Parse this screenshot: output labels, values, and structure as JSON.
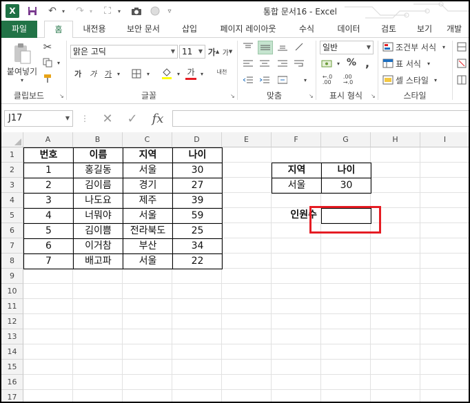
{
  "window": {
    "title": "통합 문서16 - Excel",
    "app_icon": "X"
  },
  "tabs": [
    "파일",
    "홈",
    "내전용",
    "보안 문서",
    "삽입",
    "페이지 레이아웃",
    "수식",
    "데이터",
    "검토",
    "보기",
    "개발"
  ],
  "ribbon": {
    "clipboard": {
      "paste_label": "붙여넣기",
      "group_label": "클립보드"
    },
    "font": {
      "font_name": "맑은 고딕",
      "font_size": "11",
      "group_label": "글꼴",
      "bold": "가",
      "italic": "가",
      "underline": "가",
      "font_color": "가",
      "phonetic": "내천"
    },
    "alignment": {
      "group_label": "맞춤"
    },
    "number": {
      "format": "일반",
      "percent": "%",
      "comma": ",",
      "group_label": "표시 형식"
    },
    "styles": {
      "conditional": "조건부 서식",
      "table": "표 서식",
      "cell": "셀 스타일",
      "group_label": "스타일"
    }
  },
  "formula_bar": {
    "name_box": "J17",
    "fx": "fx",
    "value": ""
  },
  "columns": [
    "A",
    "B",
    "C",
    "D",
    "E",
    "F",
    "G",
    "H",
    "I"
  ],
  "rows": [
    "1",
    "2",
    "3",
    "4",
    "5",
    "6",
    "7",
    "8",
    "9",
    "10",
    "11",
    "12",
    "13",
    "14",
    "15",
    "16",
    "17"
  ],
  "table": {
    "headers": [
      "번호",
      "이름",
      "지역",
      "나이"
    ],
    "rows": [
      [
        "1",
        "홍길동",
        "서울",
        "30"
      ],
      [
        "2",
        "김이름",
        "경기",
        "27"
      ],
      [
        "3",
        "나도요",
        "제주",
        "39"
      ],
      [
        "4",
        "너뭐야",
        "서울",
        "59"
      ],
      [
        "5",
        "김이쁨",
        "전라북도",
        "25"
      ],
      [
        "6",
        "이거참",
        "부산",
        "34"
      ],
      [
        "7",
        "배고파",
        "서울",
        "22"
      ]
    ]
  },
  "criteria": {
    "headers": [
      "지역",
      "나이"
    ],
    "values": [
      "서울",
      "30"
    ]
  },
  "count": {
    "label": "인원수",
    "value": ""
  },
  "colors": {
    "excel_green": "#217346",
    "highlight_red": "#e51c23"
  }
}
